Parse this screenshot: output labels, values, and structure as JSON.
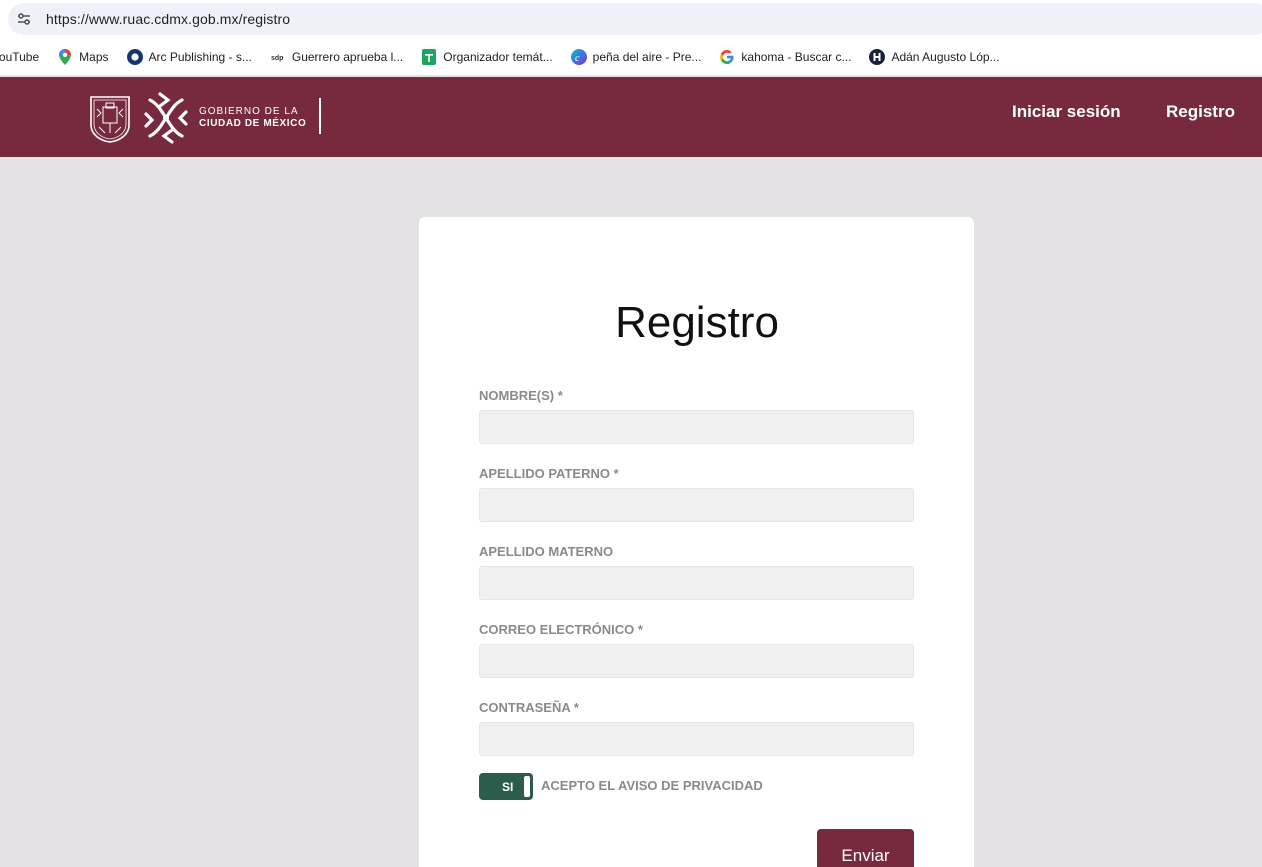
{
  "browser": {
    "url": "https://www.ruac.cdmx.gob.mx/registro",
    "bookmarks": [
      {
        "label": "YouTube",
        "icon": "youtube-icon"
      },
      {
        "label": "Maps",
        "icon": "maps-icon"
      },
      {
        "label": "Arc Publishing - s...",
        "icon": "arc-icon"
      },
      {
        "label": "Guerrero aprueba l...",
        "icon": "sdp-icon"
      },
      {
        "label": "Organizador temát...",
        "icon": "sheets-icon"
      },
      {
        "label": "peña del aire - Pre...",
        "icon": "canva-icon"
      },
      {
        "label": "kahoma - Buscar c...",
        "icon": "google-icon"
      },
      {
        "label": "Adán Augusto Lóp...",
        "icon": "circle-h-icon"
      }
    ]
  },
  "header": {
    "gov_line1": "GOBIERNO DE LA",
    "gov_line2": "CIUDAD DE MÉXICO",
    "nav": {
      "login": "Iniciar sesión",
      "register": "Registro"
    }
  },
  "form": {
    "title": "Registro",
    "fields": [
      {
        "label": "NOMBRE(S) *",
        "value": ""
      },
      {
        "label": "APELLIDO PATERNO *",
        "value": ""
      },
      {
        "label": "APELLIDO MATERNO",
        "value": ""
      },
      {
        "label": "CORREO ELECTRÓNICO *",
        "value": ""
      },
      {
        "label": "CONTRASEÑA *",
        "value": ""
      }
    ],
    "privacy_toggle": "SI",
    "privacy_text": "ACEPTO EL AVISO DE PRIVACIDAD",
    "submit": "Enviar"
  },
  "colors": {
    "brand": "#772a3d",
    "toggle": "#2c5d4c",
    "page_bg": "#e4e2e4"
  }
}
